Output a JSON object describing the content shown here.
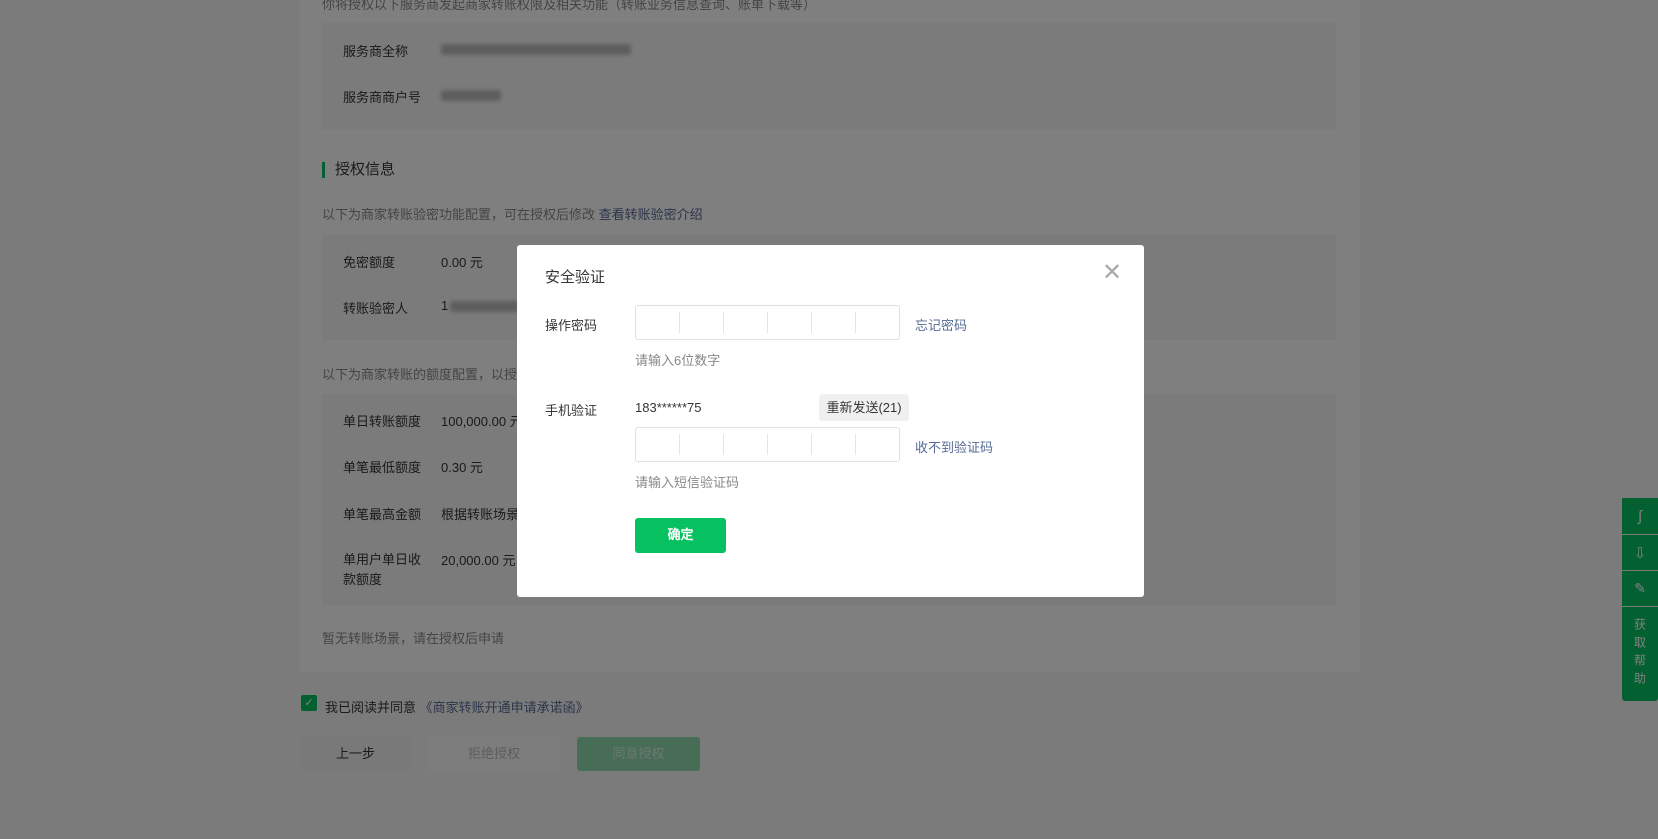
{
  "page": {
    "intro": "你将授权以下服务商发起商家转账权限及相关功能（转账业务信息查询、账单下载等）",
    "provider": {
      "name_label": "服务商全称",
      "id_label": "服务商商户号"
    },
    "auth_section": {
      "title": "授权信息",
      "desc": "以下为商家转账验密功能配置，可在授权后修改",
      "desc_link": "查看转账验密介绍",
      "rows": [
        {
          "label": "免密额度",
          "value": "0.00 元"
        },
        {
          "label": "转账验密人",
          "value": "1"
        }
      ],
      "limit_desc": "以下为商家转账的额度配置，以授权",
      "limits": [
        {
          "label": "单日转账额度",
          "value": "100,000.00 元"
        },
        {
          "label": "单笔最低额度",
          "value": "0.30 元"
        },
        {
          "label": "单笔最高金额",
          "value": "根据转账场景"
        },
        {
          "label": "单用户单日收款额度",
          "value": "20,000.00 元"
        }
      ],
      "no_scene": "暂无转账场景，请在授权后申请"
    },
    "agree": {
      "checked": true,
      "text": "我已阅读并同意",
      "link": "《商家转账开通申请承诺函》"
    },
    "buttons": {
      "prev": "上一步",
      "reject": "拒绝授权",
      "approve": "同意授权"
    }
  },
  "sidebar": {
    "items": [
      {
        "icon": "link-icon"
      },
      {
        "icon": "download-icon"
      },
      {
        "icon": "edit-icon"
      }
    ],
    "help": "获取帮助"
  },
  "dialog": {
    "title": "安全验证",
    "password_label": "操作密码",
    "forgot": "忘记密码",
    "password_hint": "请输入6位数字",
    "phone_label": "手机验证",
    "phone": "183******75",
    "resend": "重新发送(21)",
    "no_code": "收不到验证码",
    "sms_hint": "请输入短信验证码",
    "confirm": "确定"
  },
  "colors": {
    "accent": "#07c160",
    "link": "#576b95"
  }
}
